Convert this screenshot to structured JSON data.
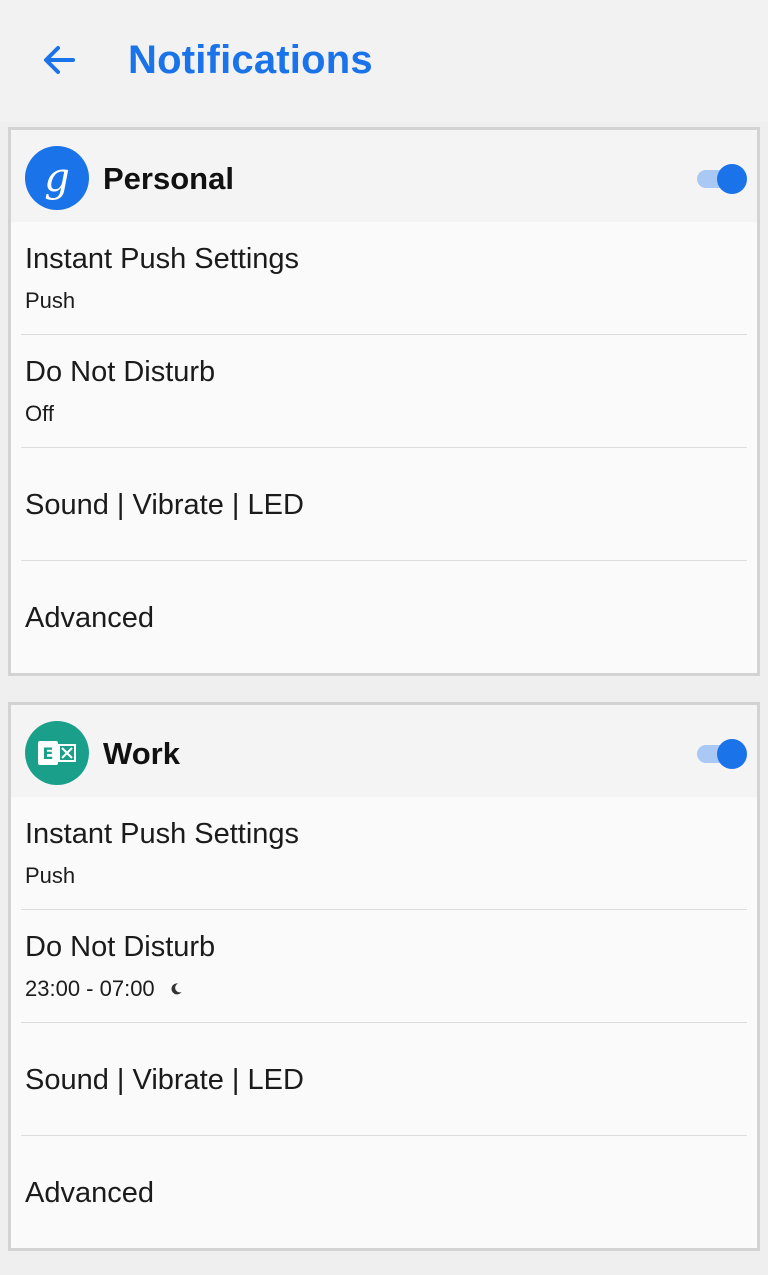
{
  "header": {
    "title": "Notifications",
    "back_icon": "arrow-left-icon"
  },
  "colors": {
    "accent": "#1a73e8",
    "exchange": "#1aa08a",
    "toggle_track": "#a9c8f3"
  },
  "accounts": [
    {
      "name": "Personal",
      "icon": "google-icon",
      "enabled": true,
      "settings": [
        {
          "title": "Instant Push Settings",
          "subtitle": "Push"
        },
        {
          "title": "Do Not Disturb",
          "subtitle": "Off"
        },
        {
          "title": "Sound | Vibrate | LED"
        },
        {
          "title": "Advanced"
        }
      ]
    },
    {
      "name": "Work",
      "icon": "exchange-icon",
      "enabled": true,
      "settings": [
        {
          "title": "Instant Push Settings",
          "subtitle": "Push"
        },
        {
          "title": "Do Not Disturb",
          "subtitle": "23:00 - 07:00",
          "subtitle_icon": "moon-icon"
        },
        {
          "title": "Sound | Vibrate | LED"
        },
        {
          "title": "Advanced"
        }
      ]
    }
  ]
}
